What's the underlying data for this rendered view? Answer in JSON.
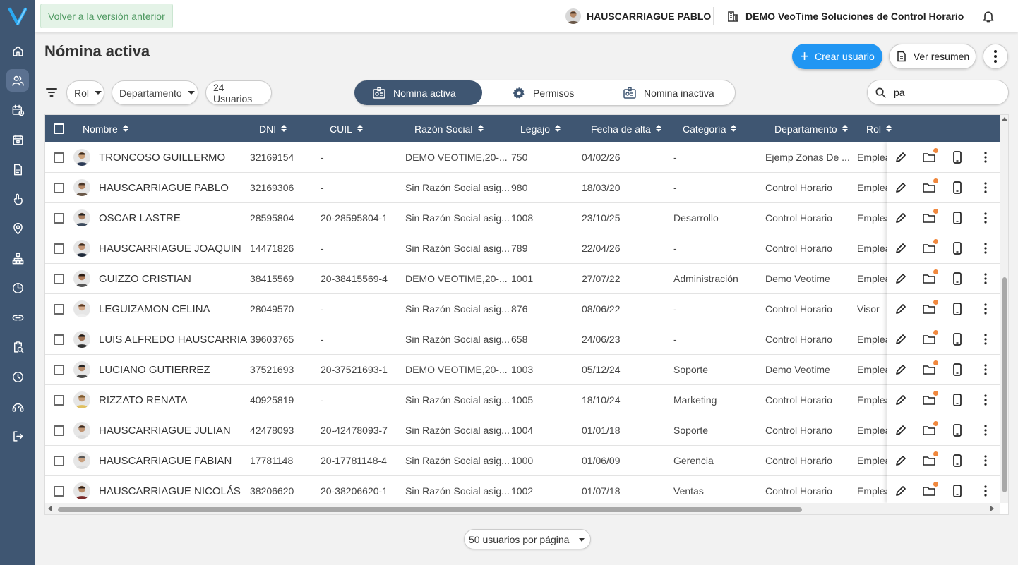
{
  "colors": {
    "sidebar": "#3f5672",
    "accent": "#2196f3",
    "header": "#3f5672",
    "back_button_bg": "#e4f3e7",
    "notification_dot": "#f0883e"
  },
  "sidebar": {
    "logo": "V",
    "items": [
      "home-icon",
      "users-icon",
      "calendar-clock-icon",
      "calendar-icon",
      "document-icon",
      "touch-icon",
      "location-icon",
      "org-chart-icon",
      "chart-icon",
      "link-icon",
      "search-doc-icon",
      "clock-icon",
      "support-icon",
      "logout-icon"
    ]
  },
  "topbar": {
    "back_label": "Volver a la versión anterior",
    "user_name": "HAUSCARRIAGUE PABLO",
    "company": "DEMO VeoTime Soluciones de Control Horario"
  },
  "page": {
    "title": "Nómina activa",
    "create_label": "Crear usuario",
    "summary_label": "Ver resumen"
  },
  "filters": {
    "rol_label": "Rol",
    "dept_label": "Departamento",
    "count_label": "24 Usuarios"
  },
  "tabs": [
    {
      "label": "Nomina activa",
      "active": true
    },
    {
      "label": "Permisos",
      "active": false
    },
    {
      "label": "Nomina inactiva",
      "active": false
    }
  ],
  "search": {
    "value": "pa"
  },
  "table": {
    "headers": [
      "Nombre",
      "DNI",
      "CUIL",
      "Razón Social",
      "Legajo",
      "Fecha de alta",
      "Categoría",
      "Departamento",
      "Rol"
    ],
    "rows": [
      {
        "name": "TRONCOSO GUILLERMO",
        "dni": "32169154",
        "cuil": "-",
        "razon": "DEMO VEOTIME,20-...",
        "legajo": "750",
        "fecha": "04/02/26",
        "categoria": "-",
        "departamento": "Ejemp Zonas De ...",
        "rol": "Emplea"
      },
      {
        "name": "HAUSCARRIAGUE PABLO",
        "dni": "32169306",
        "cuil": "-",
        "razon": "Sin Razón Social asig...",
        "legajo": "980",
        "fecha": "18/03/20",
        "categoria": "-",
        "departamento": "Control Horario",
        "rol": "Emplea"
      },
      {
        "name": "OSCAR LASTRE",
        "dni": "28595804",
        "cuil": "20-28595804-1",
        "razon": "Sin Razón Social asig...",
        "legajo": "1008",
        "fecha": "23/10/25",
        "categoria": "Desarrollo",
        "departamento": "Control Horario",
        "rol": "Emplea"
      },
      {
        "name": "HAUSCARRIAGUE JOAQUIN",
        "dni": "14471826",
        "cuil": "-",
        "razon": "Sin Razón Social asig...",
        "legajo": "789",
        "fecha": "22/04/26",
        "categoria": "-",
        "departamento": "Control Horario",
        "rol": "Emplea"
      },
      {
        "name": "GUIZZO CRISTIAN",
        "dni": "38415569",
        "cuil": "20-38415569-4",
        "razon": "DEMO VEOTIME,20-...",
        "legajo": "1001",
        "fecha": "27/07/22",
        "categoria": "Administración",
        "departamento": "Demo Veotime",
        "rol": "Emplea"
      },
      {
        "name": "LEGUIZAMON CELINA",
        "dni": "28049570",
        "cuil": "-",
        "razon": "Sin Razón Social asig...",
        "legajo": "876",
        "fecha": "08/06/22",
        "categoria": "-",
        "departamento": "Control Horario",
        "rol": "Visor"
      },
      {
        "name": "LUIS ALFREDO HAUSCARRIA...",
        "dni": "39603765",
        "cuil": "-",
        "razon": "Sin Razón Social asig...",
        "legajo": "658",
        "fecha": "24/06/23",
        "categoria": "-",
        "departamento": "Control Horario",
        "rol": "Emplea"
      },
      {
        "name": "LUCIANO GUTIERREZ",
        "dni": "37521693",
        "cuil": "20-37521693-1",
        "razon": "DEMO VEOTIME,20-...",
        "legajo": "1003",
        "fecha": "05/12/24",
        "categoria": "Soporte",
        "departamento": "Demo Veotime",
        "rol": "Emplea"
      },
      {
        "name": "RIZZATO RENATA",
        "dni": "40925819",
        "cuil": "-",
        "razon": "Sin Razón Social asig...",
        "legajo": "1005",
        "fecha": "18/10/24",
        "categoria": "Marketing",
        "departamento": "Control Horario",
        "rol": "Emplea"
      },
      {
        "name": "HAUSCARRIAGUE JULIAN",
        "dni": "42478093",
        "cuil": "20-42478093-7",
        "razon": "Sin Razón Social asig...",
        "legajo": "1004",
        "fecha": "01/01/18",
        "categoria": "Soporte",
        "departamento": "Control Horario",
        "rol": "Emplea"
      },
      {
        "name": "HAUSCARRIAGUE FABIAN",
        "dni": "17781148",
        "cuil": "20-17781148-4",
        "razon": "Sin Razón Social asig...",
        "legajo": "1000",
        "fecha": "01/06/09",
        "categoria": "Gerencia",
        "departamento": "Control Horario",
        "rol": "Emplea"
      },
      {
        "name": "HAUSCARRIAGUE NICOLÁS",
        "dni": "38206620",
        "cuil": "20-38206620-1",
        "razon": "Sin Razón Social asig...",
        "legajo": "1002",
        "fecha": "01/07/18",
        "categoria": "Ventas",
        "departamento": "Control Horario",
        "rol": "Emplea"
      }
    ],
    "row_actions": [
      "edit-icon",
      "folder-icon",
      "phone-icon",
      "more-vert-icon"
    ]
  },
  "pagination": {
    "per_page_label": "50 usuarios por página"
  }
}
